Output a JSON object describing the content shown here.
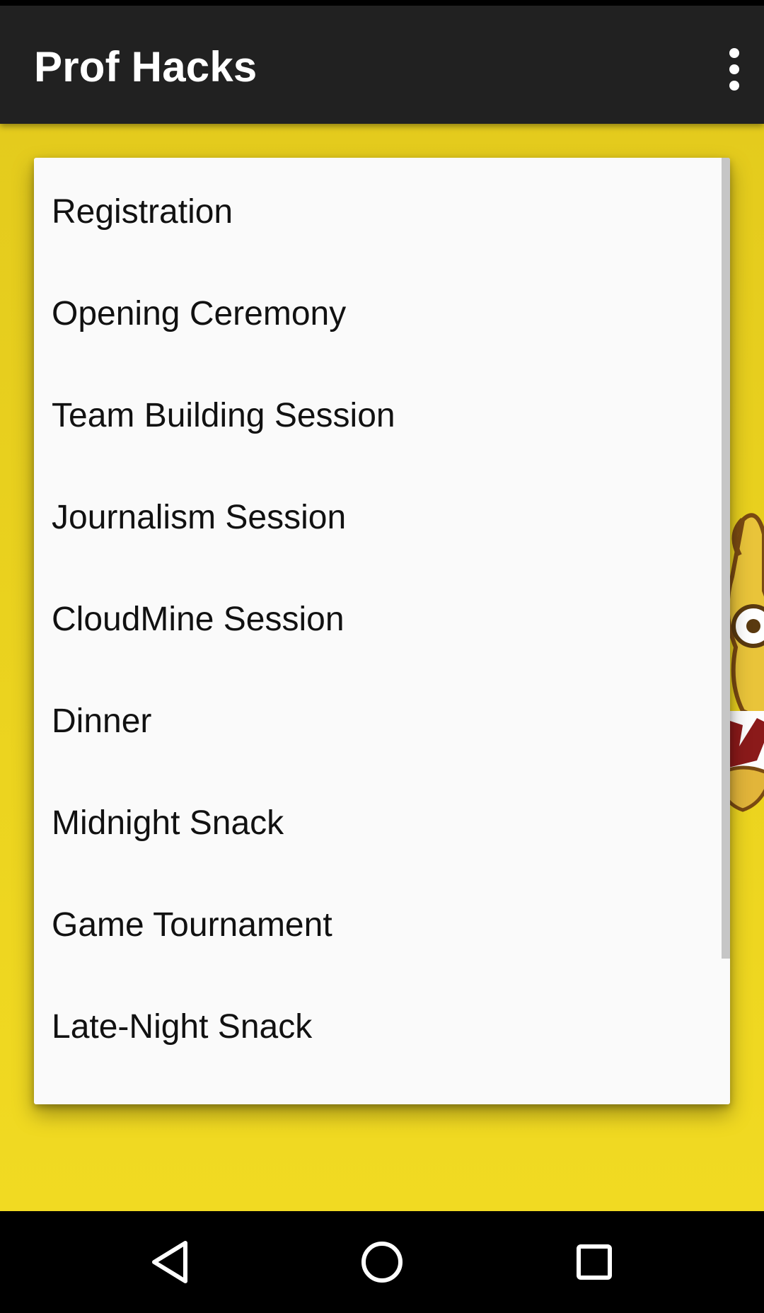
{
  "app_bar": {
    "title": "Prof Hacks",
    "overflow_icon": "more-vert-icon"
  },
  "schedule": {
    "items": [
      {
        "label": "Registration"
      },
      {
        "label": "Opening Ceremony"
      },
      {
        "label": "Team Building Session"
      },
      {
        "label": "Journalism Session"
      },
      {
        "label": "CloudMine Session"
      },
      {
        "label": "Dinner"
      },
      {
        "label": "Midnight Snack"
      },
      {
        "label": "Game Tournament"
      },
      {
        "label": "Late-Night Snack"
      }
    ]
  },
  "nav_bar": {
    "back_icon": "back-triangle-icon",
    "home_icon": "home-circle-icon",
    "recents_icon": "recents-square-icon"
  },
  "colors": {
    "app_bar": "#212121",
    "background": "#ecd41f",
    "card": "#fafafa",
    "nav_bar": "#000000"
  }
}
